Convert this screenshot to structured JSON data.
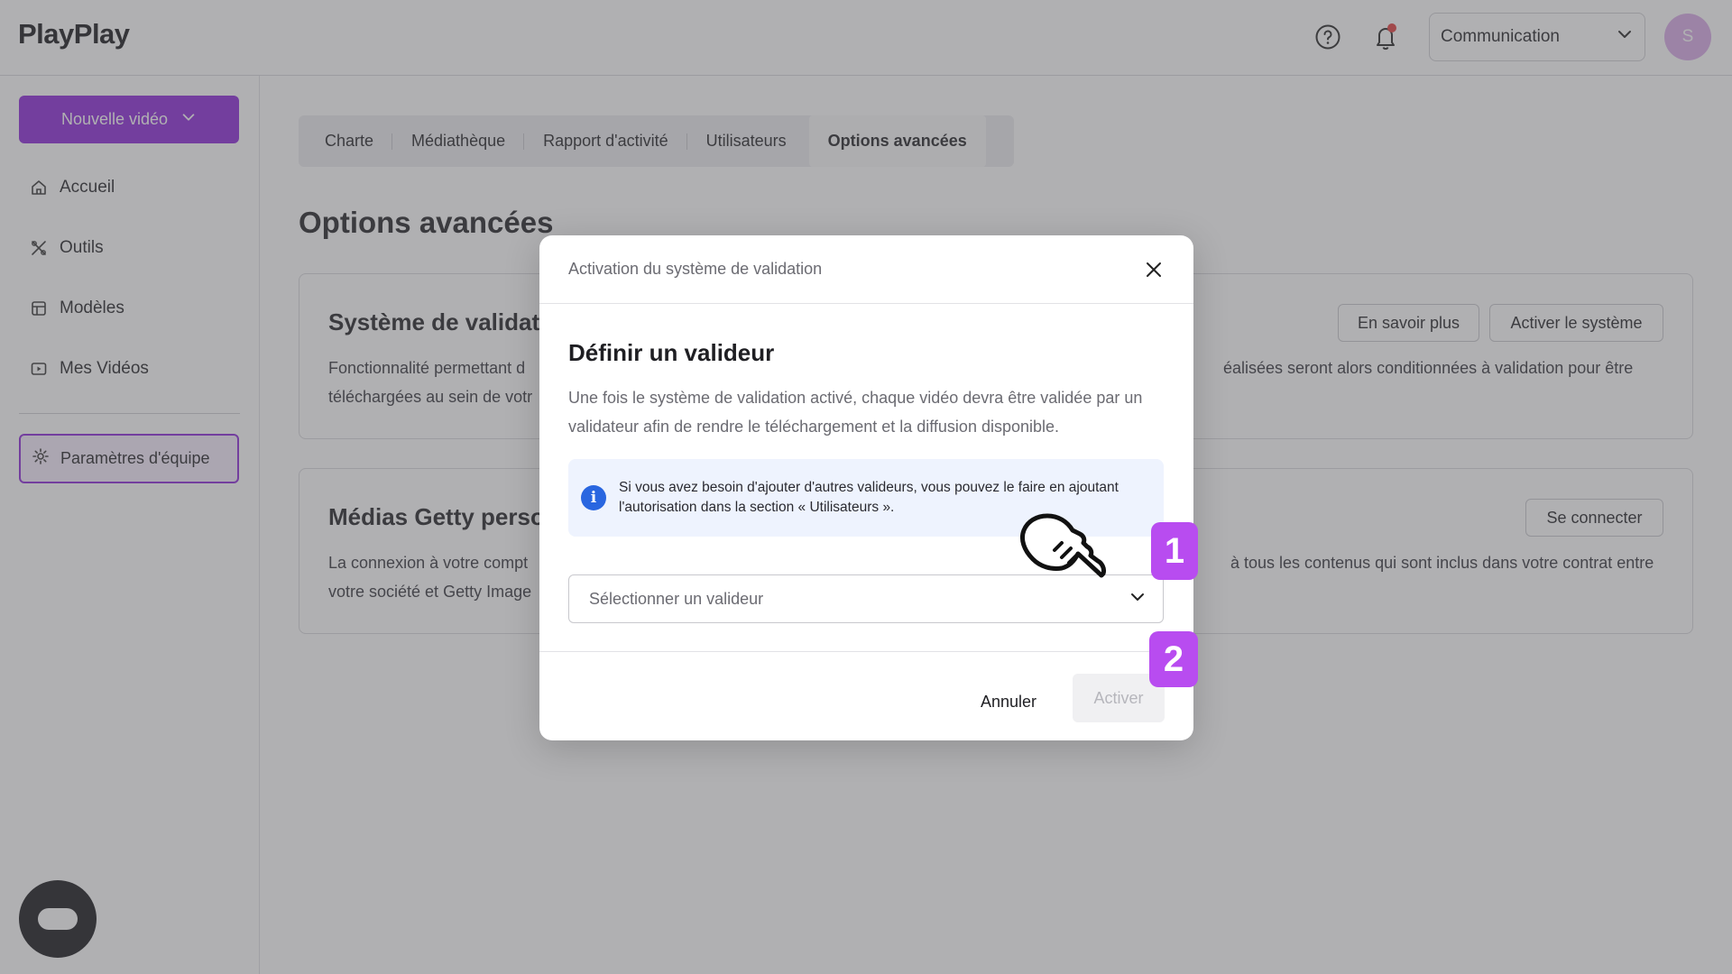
{
  "header": {
    "logo": "PlayPlay",
    "team_select": "Communication",
    "avatar_initial": "S"
  },
  "sidebar": {
    "new_video_label": "Nouvelle vidéo",
    "items": [
      {
        "label": "Accueil",
        "icon": "home-icon"
      },
      {
        "label": "Outils",
        "icon": "tools-icon"
      },
      {
        "label": "Modèles",
        "icon": "templates-icon"
      },
      {
        "label": "Mes Vidéos",
        "icon": "videos-icon"
      }
    ],
    "team_params_label": "Paramètres d'équipe"
  },
  "tabs": [
    {
      "label": "Charte"
    },
    {
      "label": "Médiathèque"
    },
    {
      "label": "Rapport d'activité"
    },
    {
      "label": "Utilisateurs"
    },
    {
      "label": "Options avancées",
      "active": true
    }
  ],
  "page_title": "Options avancées",
  "cards": {
    "validation": {
      "title": "Système de validat",
      "desc_left_1": "Fonctionnalité permettant d",
      "desc_left_2": "téléchargées au sein de votr",
      "desc_right": "éalisées seront alors conditionnées à validation pour être",
      "btn_more": "En savoir plus",
      "btn_activate": "Activer le système"
    },
    "getty": {
      "title": "Médias Getty perso",
      "desc_left_1": "La connexion à votre compt",
      "desc_left_2": "votre société et Getty Image",
      "desc_right": "à tous les contenus qui sont inclus dans votre contrat entre",
      "btn_connect": "Se connecter"
    }
  },
  "modal": {
    "header": "Activation du système de validation",
    "title": "Définir un valideur",
    "description": "Une fois le système de validation activé, chaque vidéo devra être validée par un validateur afin de rendre le téléchargement et la diffusion disponible.",
    "info_icon_glyph": "i",
    "info_text": "Si vous avez besoin d'ajouter d'autres valideurs, vous pouvez le faire en ajoutant l'autorisation dans la section « Utilisateurs ».",
    "select_placeholder": "Sélectionner un valideur",
    "cancel_label": "Annuler",
    "activate_label": "Activer"
  },
  "steps": [
    "1",
    "2"
  ],
  "colors": {
    "brand_purple": "#8b26d9",
    "step_badge": "#b84cf0",
    "info_blue": "#2966e0",
    "notification_red": "#e23b3b"
  }
}
